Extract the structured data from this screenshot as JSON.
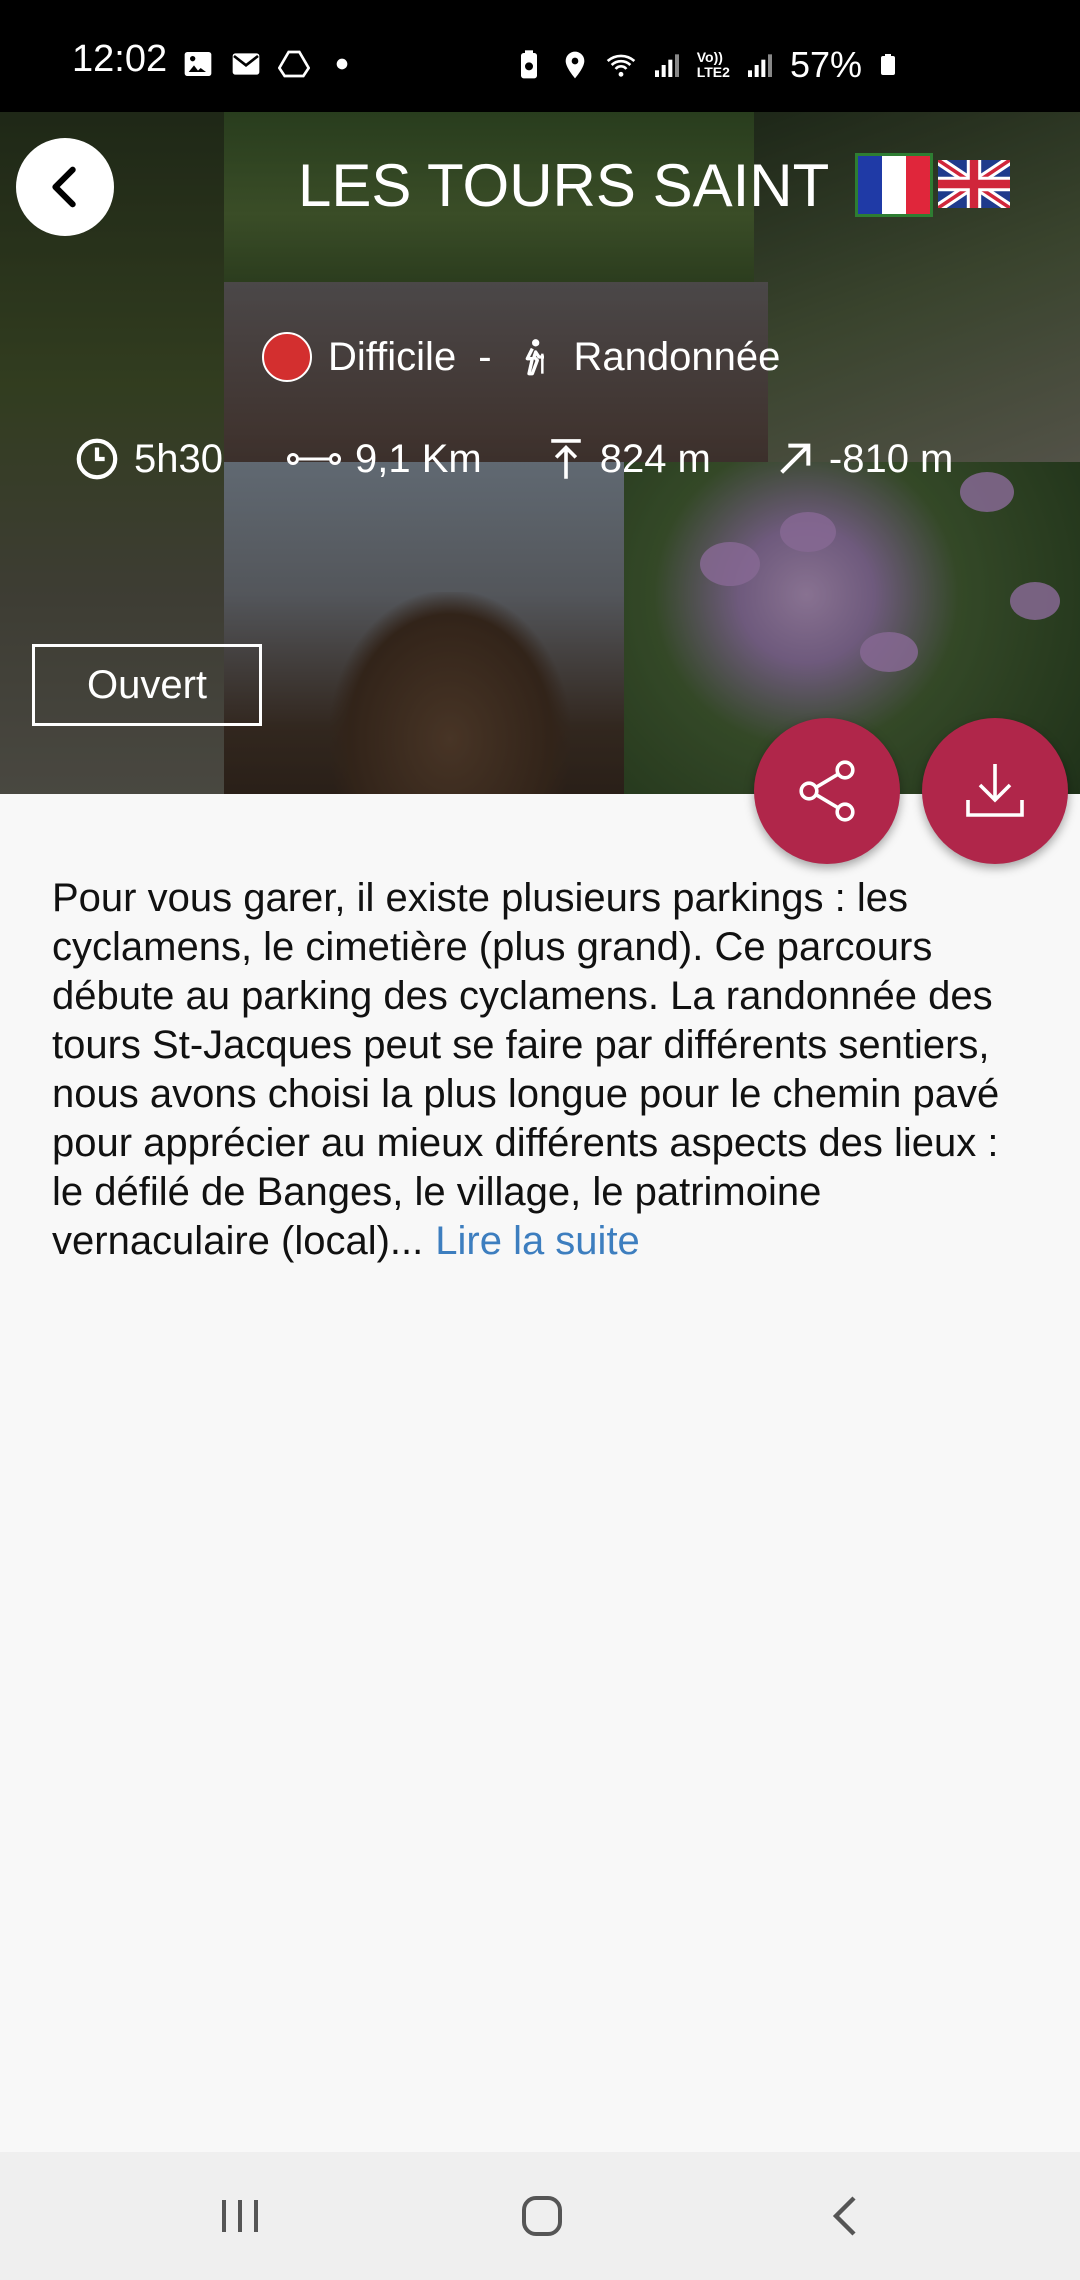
{
  "status_bar": {
    "time": "12:02",
    "battery": "57%",
    "icons_left": [
      "image-icon",
      "mail-icon",
      "drive-icon",
      "dot-icon"
    ],
    "icons_right": [
      "battery-saver-icon",
      "location-icon",
      "wifi-icon",
      "signal-icon",
      "volte-icon",
      "signal-icon"
    ],
    "network_label_1": "Vo))",
    "network_label_2": "LTE2"
  },
  "header": {
    "title": "LES TOURS SAINT",
    "languages": [
      "fr",
      "en"
    ]
  },
  "trail": {
    "difficulty": "Difficile",
    "separator": "-",
    "activity": "Randonnée",
    "difficulty_color": "#d32f2f",
    "duration": "5h30",
    "distance": "9,1 Km",
    "elevation_gain": "824 m",
    "elevation_loss": "-810 m",
    "status": "Ouvert"
  },
  "description": {
    "text": "Pour vous garer, il existe plusieurs parkings : les cyclamens, le cimetière (plus grand). Ce parcours débute au parking des cyclamens. La randonnée des tours St-Jacques peut se faire par différents sentiers, nous avons choisi la plus longue pour le chemin pavé pour apprécier au mieux différents aspects des lieux : le défilé de Banges, le village, le patrimoine vernaculaire (local)...",
    "read_more": "Lire la suite"
  },
  "colors": {
    "accent": "#b0264a",
    "link": "#3d7ebf"
  }
}
